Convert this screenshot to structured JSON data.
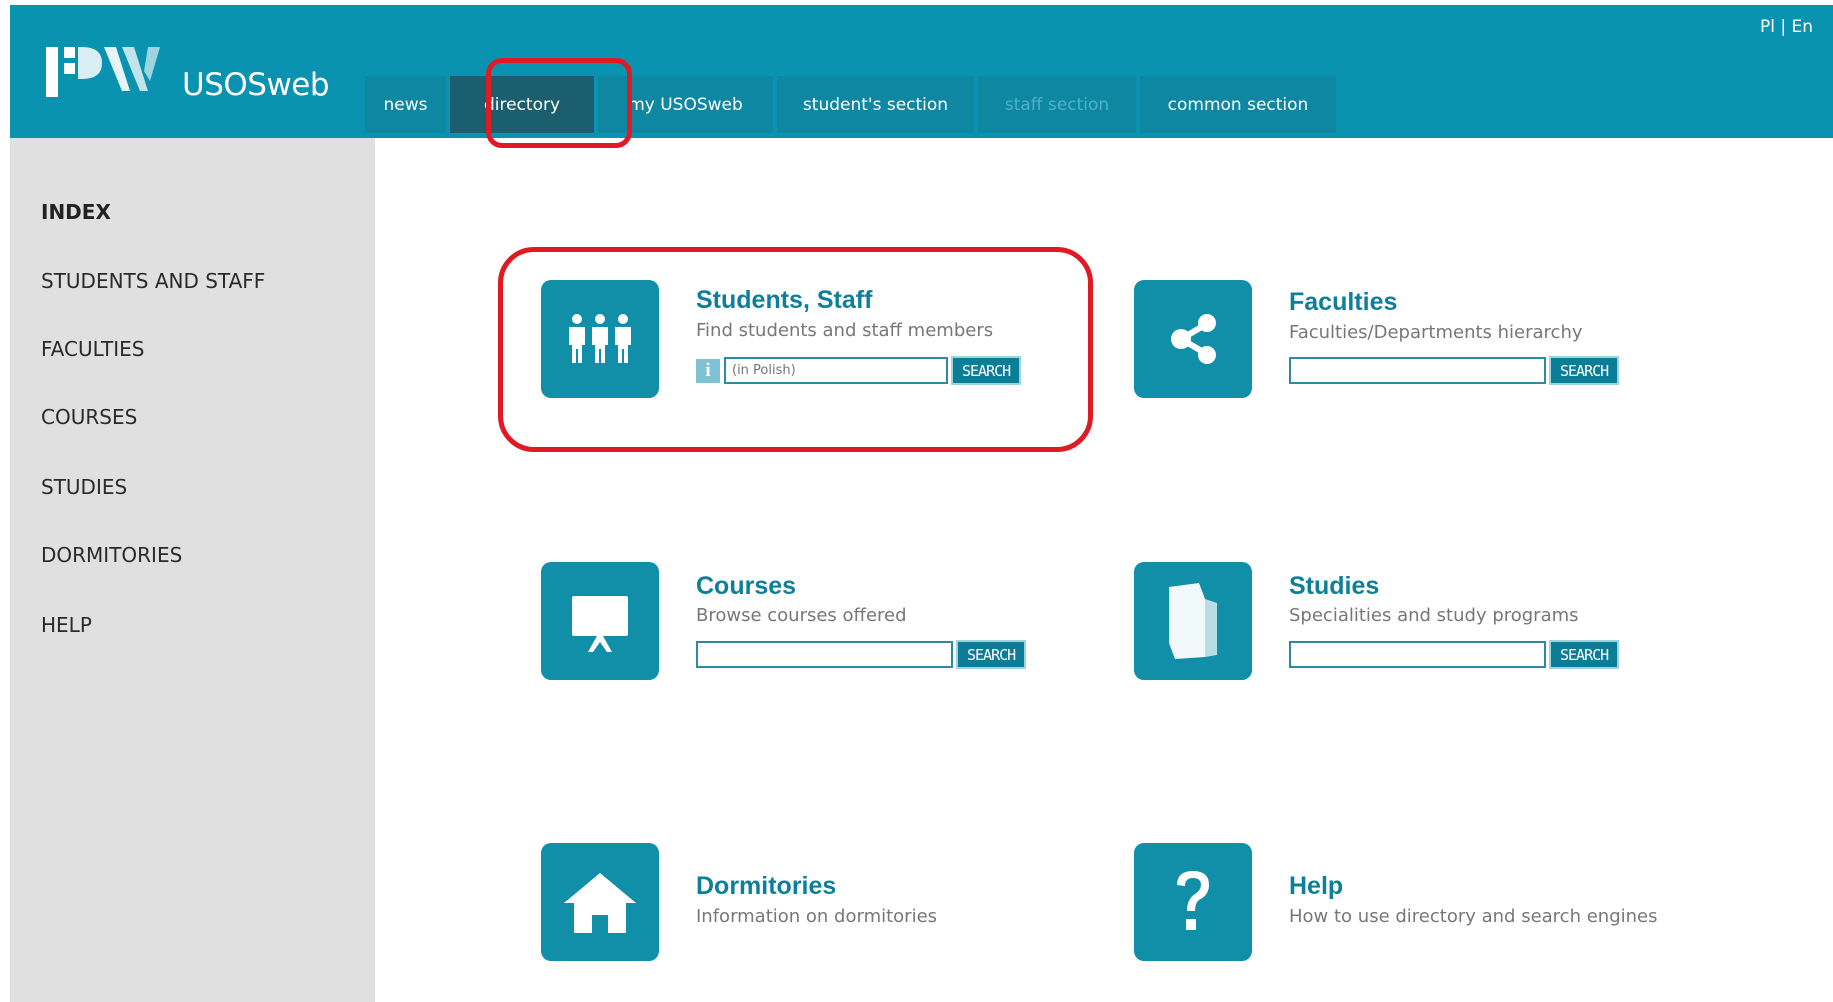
{
  "app": {
    "logo_text": "USOSweb",
    "lang_pl": "Pl",
    "lang_sep": " | ",
    "lang_en": "En"
  },
  "tabs": [
    {
      "label": "news",
      "state": "normal"
    },
    {
      "label": "directory",
      "state": "active"
    },
    {
      "label": "my USOSweb",
      "state": "normal"
    },
    {
      "label": "student's section",
      "state": "normal"
    },
    {
      "label": "staff section",
      "state": "disabled"
    },
    {
      "label": "common section",
      "state": "normal"
    }
  ],
  "sidebar": {
    "items": [
      {
        "label": "INDEX",
        "active": true
      },
      {
        "label": "STUDENTS AND STAFF"
      },
      {
        "label": "FACULTIES"
      },
      {
        "label": "COURSES"
      },
      {
        "label": "STUDIES"
      },
      {
        "label": "DORMITORIES"
      },
      {
        "label": "HELP"
      }
    ]
  },
  "cards": {
    "students": {
      "title": "Students, Staff",
      "desc": "Find students and staff members",
      "placeholder": "(in Polish)",
      "button": "SEARCH",
      "info": "i",
      "icon": "people-icon"
    },
    "faculties": {
      "title": "Faculties",
      "desc": "Faculties/Departments hierarchy",
      "placeholder": "",
      "button": "SEARCH",
      "icon": "share-icon"
    },
    "courses": {
      "title": "Courses",
      "desc": "Browse courses offered",
      "placeholder": "",
      "button": "SEARCH",
      "icon": "presentation-board-icon"
    },
    "studies": {
      "title": "Studies",
      "desc": "Specialities and study programs",
      "placeholder": "",
      "button": "SEARCH",
      "icon": "book-icon"
    },
    "dormitories": {
      "title": "Dormitories",
      "desc": "Information on dormitories",
      "icon": "house-icon"
    },
    "help": {
      "title": "Help",
      "desc": "How to use directory and search engines",
      "icon": "question-mark-icon"
    }
  },
  "colors": {
    "header": "#0a93b0",
    "tab": "#0d87a2",
    "tab_active": "#1b5f6e",
    "tile": "#118ea8",
    "title": "#0d7f98",
    "highlight": "#e01a22",
    "sidebar": "#e0e0e0"
  }
}
